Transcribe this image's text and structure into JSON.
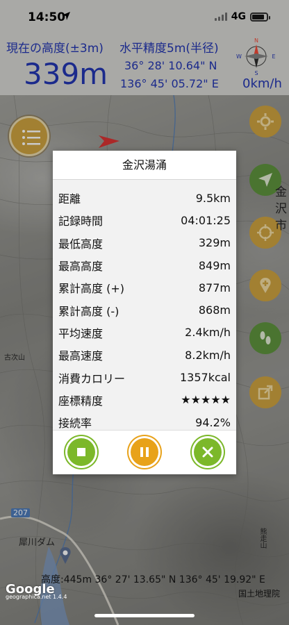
{
  "status": {
    "time": "14:50",
    "network": "4G"
  },
  "header": {
    "altitude_label": "現在の高度(±3m)",
    "altitude_value": "339m",
    "accuracy_label": "水平精度5m(半径)",
    "latitude": "36° 28' 10.64\" N",
    "longitude": "136° 45' 05.72\" E",
    "speed": "0km/h"
  },
  "compass": {
    "n": "N",
    "s": "S",
    "e": "E",
    "w": "W"
  },
  "map_labels": {
    "place1": "金",
    "place2": "沢",
    "place3": "市",
    "road": "207",
    "dam": "犀川ダム",
    "village": "古次山",
    "mountain": "熊走山"
  },
  "dialog": {
    "title": "金沢湯涌",
    "stats": [
      {
        "label": "距離",
        "value": "9.5km"
      },
      {
        "label": "記録時間",
        "value": "04:01:25"
      },
      {
        "label": "最低高度",
        "value": "329m"
      },
      {
        "label": "最高高度",
        "value": "849m"
      },
      {
        "label": "累計高度 (+)",
        "value": "877m"
      },
      {
        "label": "累計高度 (-)",
        "value": "868m"
      },
      {
        "label": "平均速度",
        "value": "2.4km/h"
      },
      {
        "label": "最高速度",
        "value": "8.2km/h"
      },
      {
        "label": "消費カロリー",
        "value": "1357kcal"
      },
      {
        "label": "座標精度",
        "value": "★★★★★"
      },
      {
        "label": "接続率",
        "value": "94.2%"
      }
    ]
  },
  "bottom": {
    "coords": "高度:445m  36° 27' 13.65\" N 136° 45' 19.92\" E",
    "google": "Google",
    "attribution": "国土地理院",
    "version": "geographica.net 1.4.4"
  },
  "colors": {
    "header_text": "#1b2a8c",
    "stop_button": "#7cb82a",
    "pause_button": "#e8a21a",
    "menu_button": "#c99a2e"
  }
}
